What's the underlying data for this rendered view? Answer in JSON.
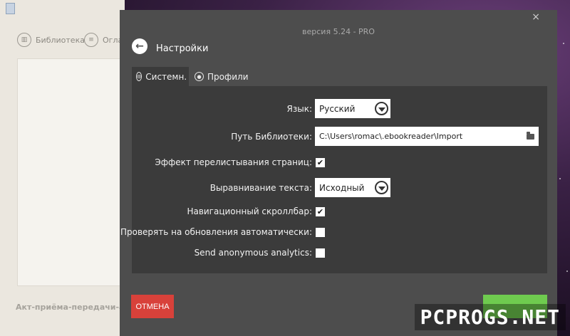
{
  "background_app": {
    "tabs": [
      {
        "label": "Библиотека",
        "icon": "books-icon"
      },
      {
        "label": "Огла",
        "icon": "list-icon"
      }
    ],
    "document_title": "Акт-приёма-передачи-авт"
  },
  "dialog": {
    "version": "версия 5.24 - PRO",
    "close_glyph": "×",
    "back_icon": "back-arrow-icon",
    "title": "Настройки",
    "tabs": [
      {
        "label": "Системн.",
        "icon": "gears-icon",
        "selected": true
      },
      {
        "label": "Профили",
        "icon": "profile-icon",
        "selected": false
      }
    ],
    "settings": {
      "language": {
        "label": "Язык:",
        "value": "Русский"
      },
      "library_path": {
        "label": "Путь Библиотеки:",
        "value": "C:\\Users\\romac\\.ebookreader\\Import",
        "icon": "folder-icon"
      },
      "page_flip": {
        "label": "Эффект перелистывания страниц:",
        "checked": true
      },
      "text_align": {
        "label": "Выравнивание текста:",
        "value": "Исходный"
      },
      "nav_scrollbar": {
        "label": "Навигационный скроллбар:",
        "checked": true
      },
      "auto_update": {
        "label": "Проверять на обновления автоматически:",
        "checked": false
      },
      "analytics": {
        "label": "Send anonymous analytics:",
        "checked": false
      }
    },
    "cancel_label": "ОТМЕНА",
    "checkmark": "✔"
  },
  "watermark": "PCPROGS.NET",
  "colors": {
    "dialog_bg": "#4d4d4d",
    "panel_bg": "#3b3b3b",
    "cancel": "#d8413a",
    "ok": "#6fcb4f"
  }
}
